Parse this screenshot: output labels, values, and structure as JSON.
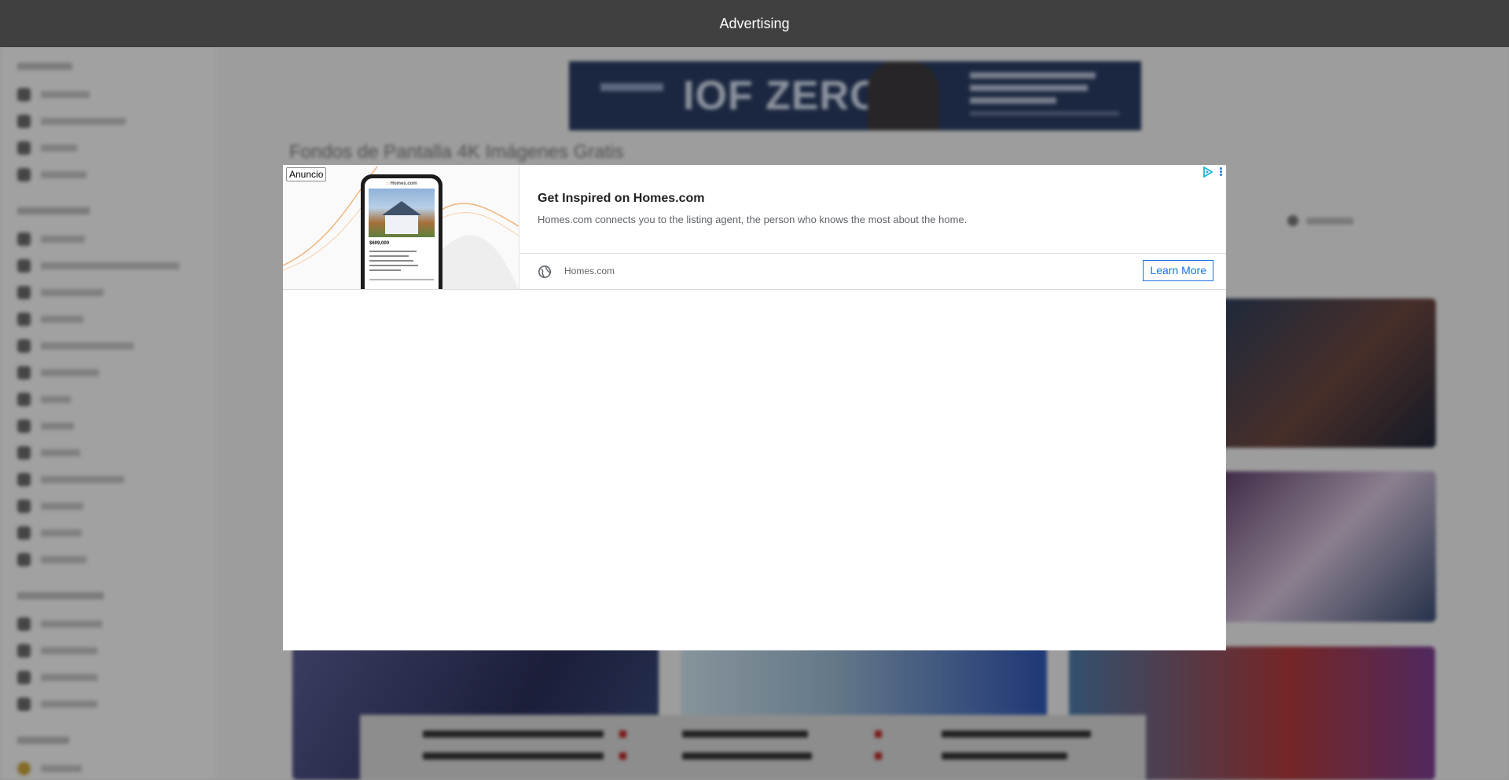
{
  "top_bar": {
    "title": "Advertising"
  },
  "ad": {
    "label": "Anuncio",
    "headline": "Get Inspired on Homes.com",
    "description": "Homes.com connects you to the listing agent, the person who knows the most about the home.",
    "domain": "Homes.com",
    "cta": "Learn More",
    "phone": {
      "logo": "Homes.com",
      "price": "$609,000"
    }
  },
  "background": {
    "banner": {
      "headline": "IOF ZERO"
    },
    "page_title": "Fondos de Pantalla 4K Imágenes Gratis"
  },
  "colors": {
    "top_bar": "#404040",
    "cta_blue": "#1a73e8",
    "overlay": "rgba(0,0,0,0.35)"
  }
}
